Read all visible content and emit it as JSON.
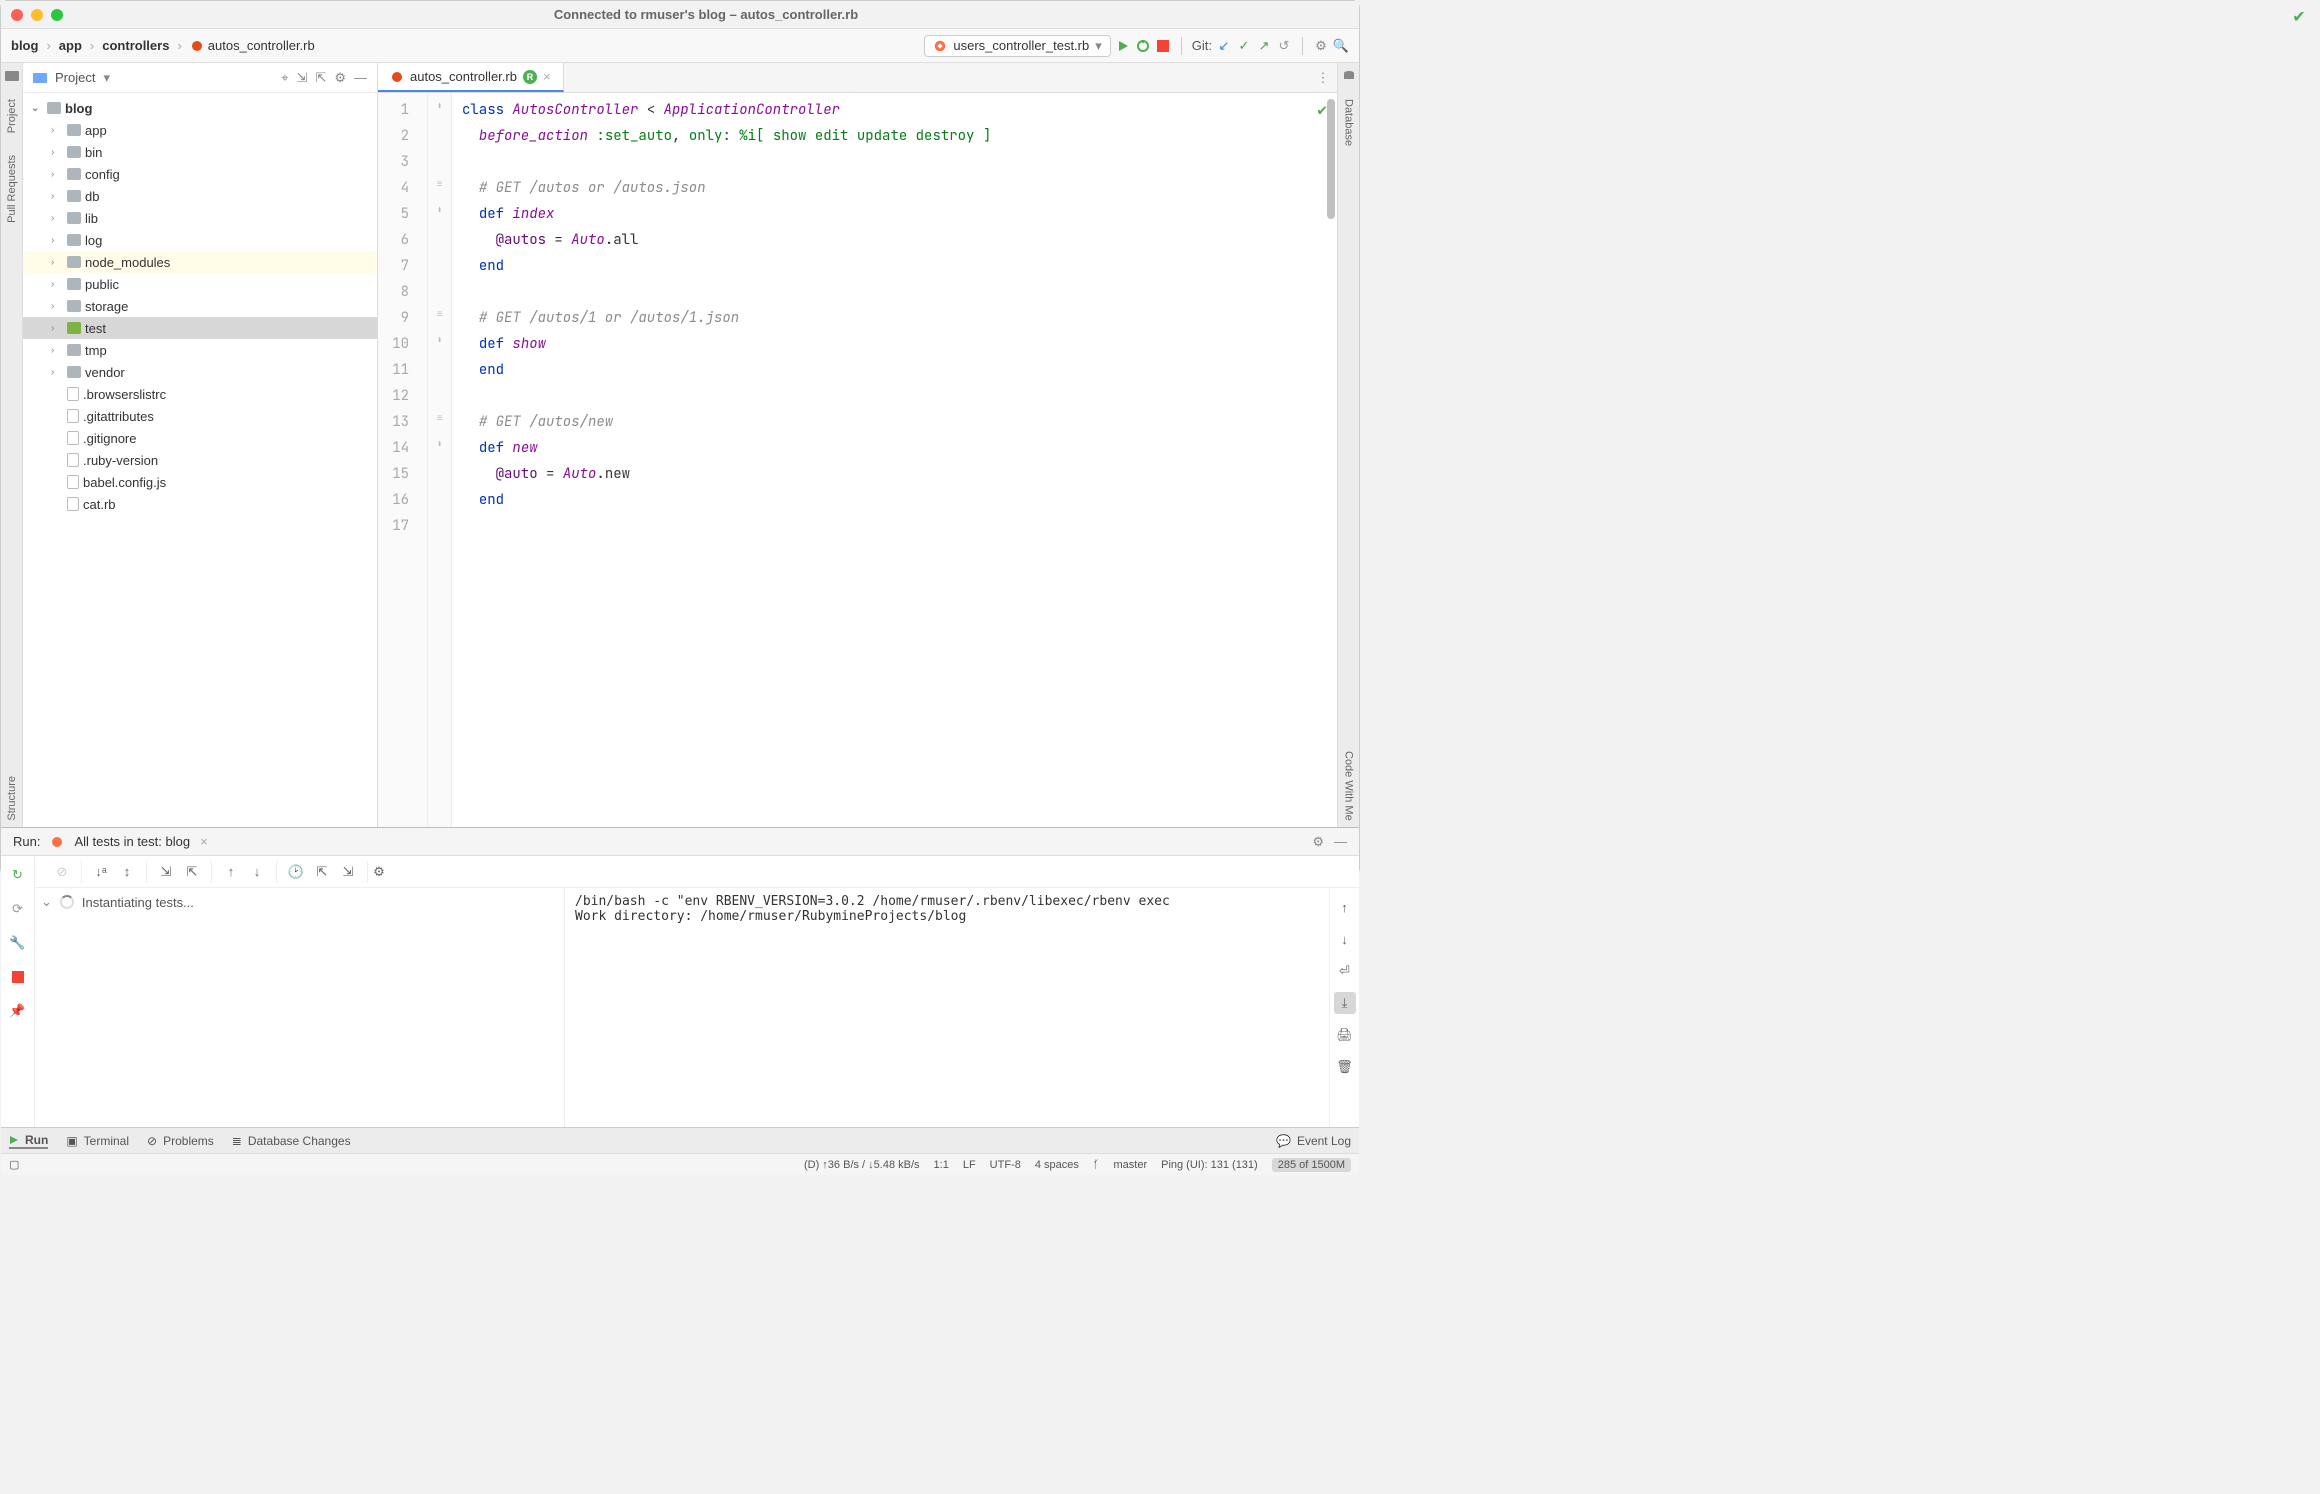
{
  "window": {
    "title": "Connected to rmuser's blog – autos_controller.rb"
  },
  "breadcrumbs": [
    "blog",
    "app",
    "controllers",
    "autos_controller.rb"
  ],
  "run_config": {
    "label": "users_controller_test.rb"
  },
  "git": {
    "label": "Git:"
  },
  "sidebar": {
    "header": "Project",
    "tree": [
      {
        "depth": 0,
        "label": "blog",
        "kind": "folder",
        "open": true,
        "bold": true
      },
      {
        "depth": 1,
        "label": "app",
        "kind": "folder",
        "open": false
      },
      {
        "depth": 1,
        "label": "bin",
        "kind": "folder",
        "open": false
      },
      {
        "depth": 1,
        "label": "config",
        "kind": "folder",
        "open": false
      },
      {
        "depth": 1,
        "label": "db",
        "kind": "folder",
        "open": false
      },
      {
        "depth": 1,
        "label": "lib",
        "kind": "folder",
        "open": false
      },
      {
        "depth": 1,
        "label": "log",
        "kind": "folder",
        "open": false
      },
      {
        "depth": 1,
        "label": "node_modules",
        "kind": "folder",
        "open": false,
        "hl": true
      },
      {
        "depth": 1,
        "label": "public",
        "kind": "folder",
        "open": false
      },
      {
        "depth": 1,
        "label": "storage",
        "kind": "folder",
        "open": false
      },
      {
        "depth": 1,
        "label": "test",
        "kind": "folder",
        "open": false,
        "sel": true,
        "test": true
      },
      {
        "depth": 1,
        "label": "tmp",
        "kind": "folder",
        "open": false
      },
      {
        "depth": 1,
        "label": "vendor",
        "kind": "folder",
        "open": false
      },
      {
        "depth": 1,
        "label": ".browserslistrc",
        "kind": "file"
      },
      {
        "depth": 1,
        "label": ".gitattributes",
        "kind": "file"
      },
      {
        "depth": 1,
        "label": ".gitignore",
        "kind": "file"
      },
      {
        "depth": 1,
        "label": ".ruby-version",
        "kind": "file"
      },
      {
        "depth": 1,
        "label": "babel.config.js",
        "kind": "file"
      },
      {
        "depth": 1,
        "label": "cat.rb",
        "kind": "file"
      }
    ]
  },
  "tabs": [
    {
      "label": "autos_controller.rb",
      "badge": "R"
    }
  ],
  "editor": {
    "lines": [
      {
        "n": 1,
        "html": "<span class='kw'>class</span> <span class='cls'>AutosController</span> &lt; <span class='cls'>ApplicationController</span>"
      },
      {
        "n": 2,
        "html": "  <span class='fn'>before_action</span> <span class='sym'>:set_auto</span>, <span class='sym'>only:</span> <span class='sym'>%i[ show edit update destroy ]</span>"
      },
      {
        "n": 3,
        "html": ""
      },
      {
        "n": 4,
        "html": "  <span class='cm'># GET /autos or /autos.json</span>"
      },
      {
        "n": 5,
        "html": "  <span class='kw'>def</span> <span class='fn'>index</span>"
      },
      {
        "n": 6,
        "html": "    <span class='iv'>@autos</span> = <span class='cls'>Auto</span>.all"
      },
      {
        "n": 7,
        "html": "  <span class='kw'>end</span>"
      },
      {
        "n": 8,
        "html": ""
      },
      {
        "n": 9,
        "html": "  <span class='cm'># GET /autos/1 or /autos/1.json</span>"
      },
      {
        "n": 10,
        "html": "  <span class='kw'>def</span> <span class='fn'>show</span>"
      },
      {
        "n": 11,
        "html": "  <span class='kw'>end</span>"
      },
      {
        "n": 12,
        "html": ""
      },
      {
        "n": 13,
        "html": "  <span class='cm'># GET /autos/new</span>"
      },
      {
        "n": 14,
        "html": "  <span class='kw'>def</span> <span class='fn'>new</span>"
      },
      {
        "n": 15,
        "html": "    <span class='iv'>@auto</span> = <span class='cls'>Auto</span>.new"
      },
      {
        "n": 16,
        "html": "  <span class='kw'>end</span>"
      },
      {
        "n": 17,
        "html": ""
      }
    ]
  },
  "runpanel": {
    "title_prefix": "Run:",
    "title": "All tests in test: blog",
    "tree_label": "Instantiating tests...",
    "console": {
      "line1": "/bin/bash -c \"env RBENV_VERSION=3.0.2 /home/rmuser/.rbenv/libexec/rbenv exec",
      "line2": "Work directory: /home/rmuser/RubymineProjects/blog"
    }
  },
  "bottom_tabs": {
    "run": "Run",
    "terminal": "Terminal",
    "problems": "Problems",
    "db": "Database Changes",
    "event": "Event Log"
  },
  "left_stripe": {
    "project": "Project",
    "pull": "Pull Requests",
    "structure": "Structure"
  },
  "right_stripe": {
    "database": "Database",
    "codewithme": "Code With Me"
  },
  "status": {
    "net": "(D) ↑36 B/s / ↓5.48 kB/s",
    "pos": "1:1",
    "le": "LF",
    "enc": "UTF-8",
    "indent": "4 spaces",
    "branch": "master",
    "ping": "Ping (UI): 131 (131)",
    "mem": "285 of 1500M"
  }
}
